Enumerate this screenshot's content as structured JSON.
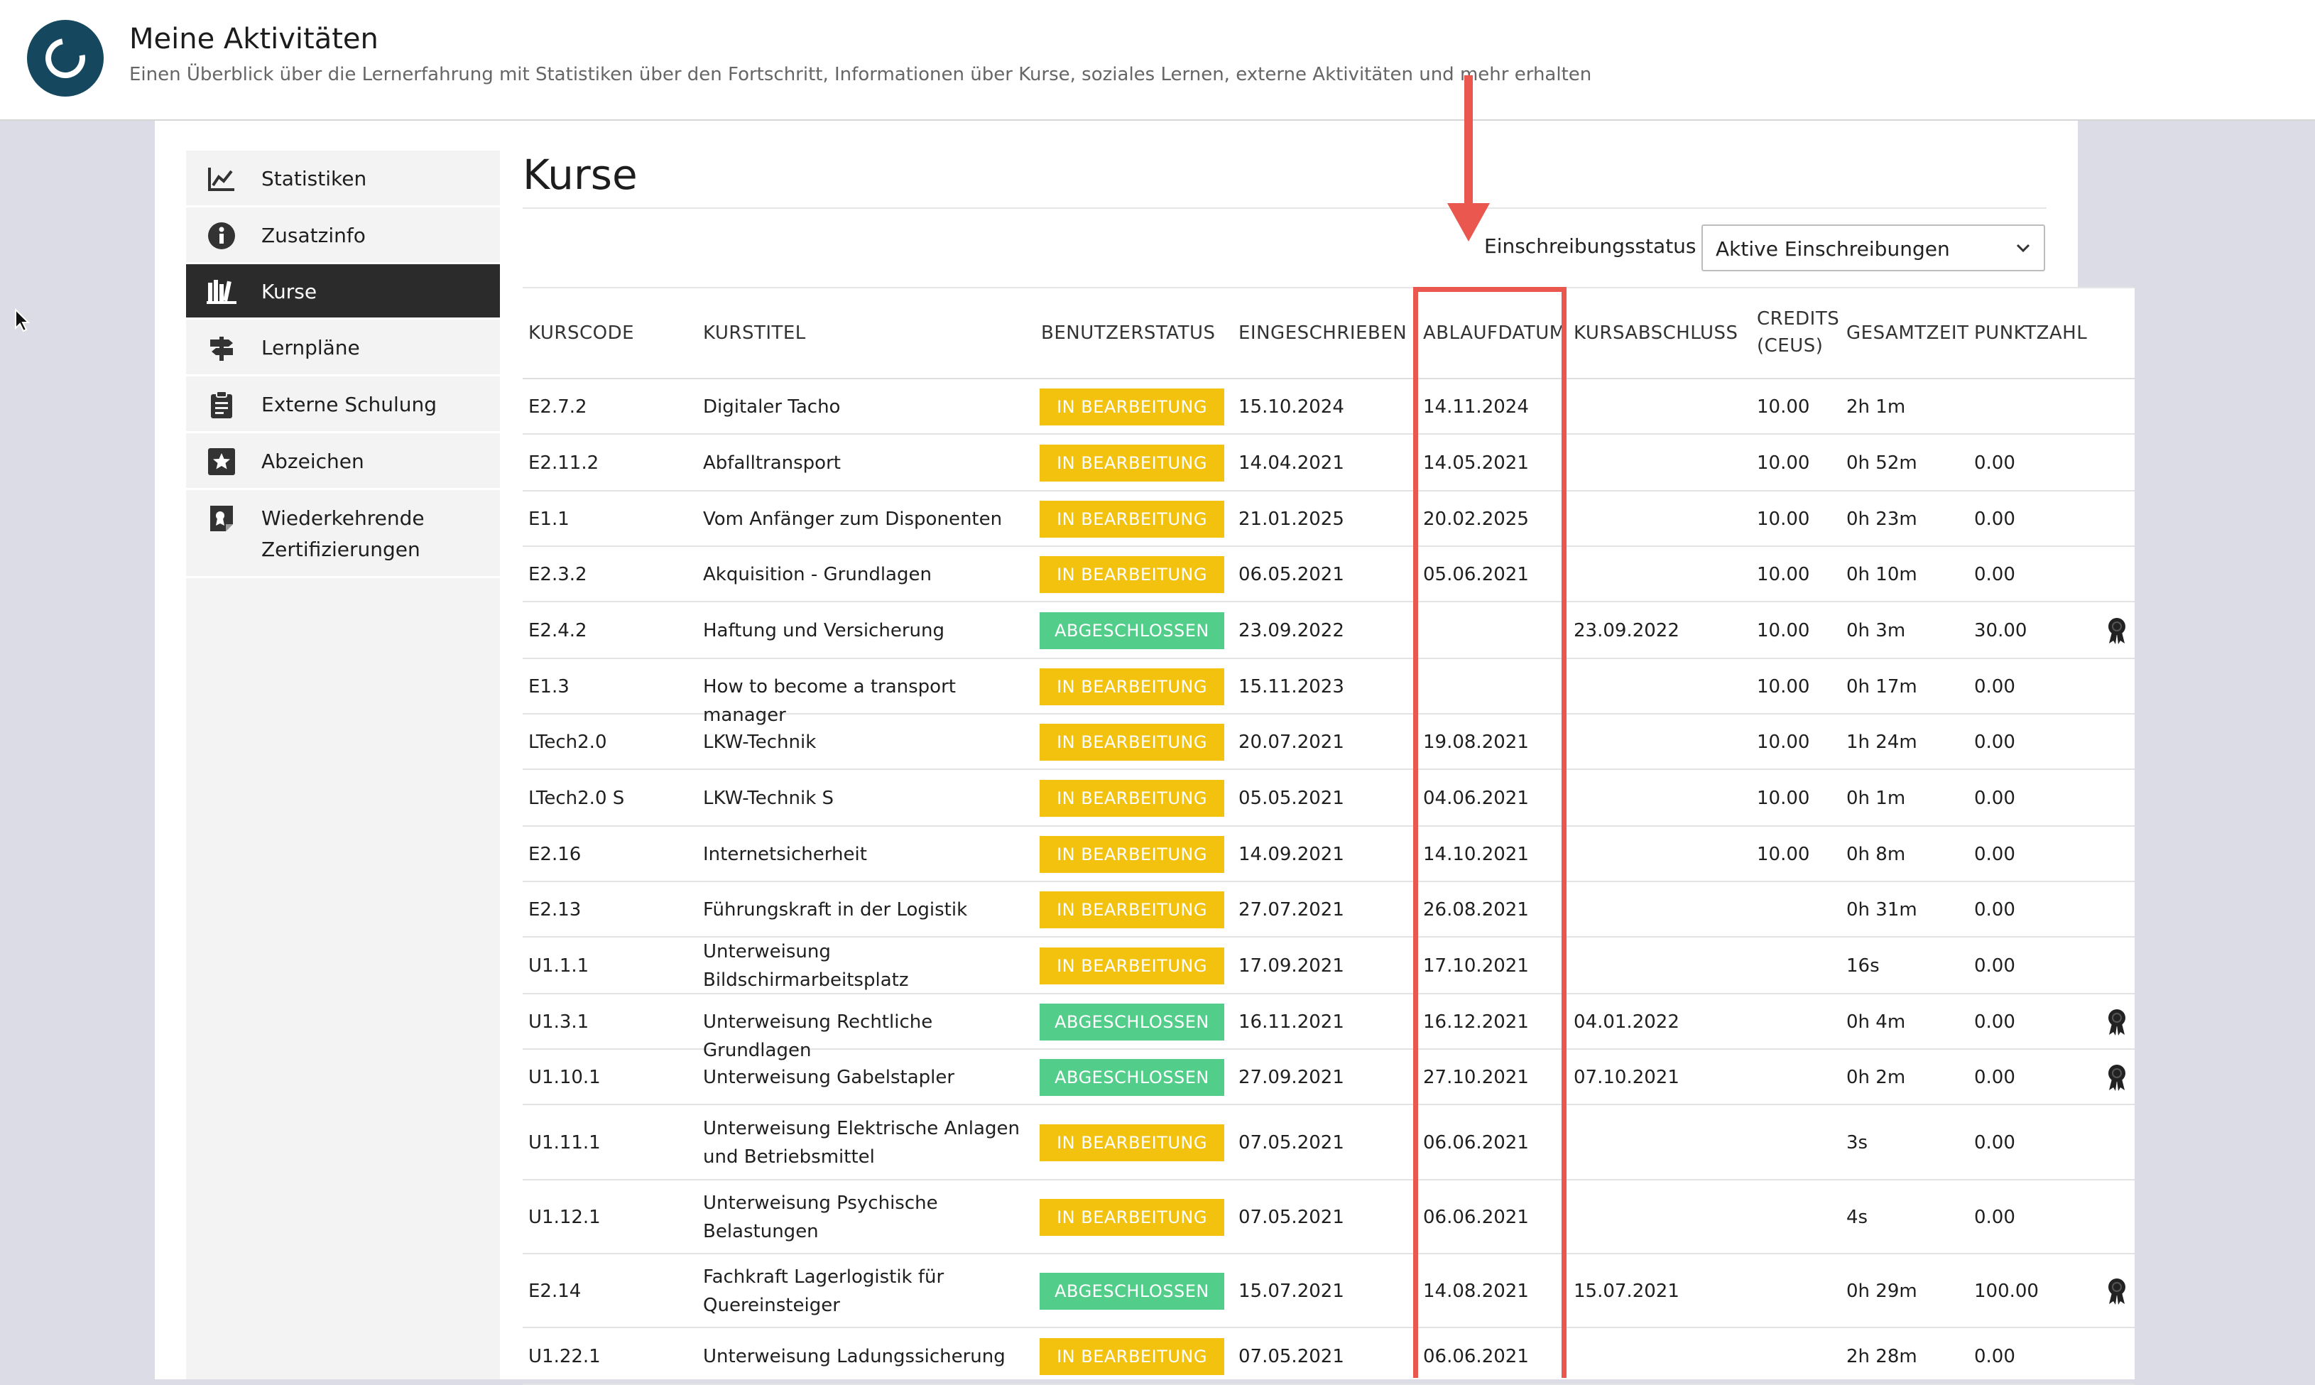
{
  "header": {
    "title": "Meine Aktivitäten",
    "subtitle": "Einen Überblick über die Lernerfahrung mit Statistiken über den Fortschritt, Informationen über Kurse, soziales Lernen, externe Aktivitäten und mehr erhalten"
  },
  "sidebar": {
    "items": [
      {
        "label": "Statistiken",
        "icon": "chart-icon"
      },
      {
        "label": "Zusatzinfo",
        "icon": "info-icon"
      },
      {
        "label": "Kurse",
        "icon": "library-icon",
        "active": true
      },
      {
        "label": "Lernpläne",
        "icon": "signpost-icon"
      },
      {
        "label": "Externe Schulung",
        "icon": "clipboard-icon"
      },
      {
        "label": "Abzeichen",
        "icon": "star-badge-icon"
      },
      {
        "label": "Wiederkehrende\nZertifizierungen",
        "icon": "certificate-icon"
      }
    ]
  },
  "main": {
    "title": "Kurse",
    "filter_label": "Einschreibungsstatus",
    "filter_value": "Aktive Einschreibungen"
  },
  "table": {
    "headers": [
      "KURSCODE",
      "KURSTITEL",
      "BENUTZERSTATUS",
      "EINGESCHRIEBEN",
      "ABLAUFDATUM",
      "KURSABSCHLUSS",
      "CREDITS (CEUS)",
      "GESAMTZEIT",
      "PUNKTZAHL"
    ],
    "rows": [
      {
        "code": "E2.7.2",
        "title": "Digitaler Tacho",
        "status": "IN BEARBEITUNG",
        "enrolled": "15.10.2024",
        "expiry": "14.11.2024",
        "completed": "",
        "credits": "10.00",
        "time": "2h 1m",
        "score": "",
        "award": false
      },
      {
        "code": "E2.11.2",
        "title": "Abfalltransport",
        "status": "IN BEARBEITUNG",
        "enrolled": "14.04.2021",
        "expiry": "14.05.2021",
        "completed": "",
        "credits": "10.00",
        "time": "0h 52m",
        "score": "0.00",
        "award": false
      },
      {
        "code": "E1.1",
        "title": "Vom Anfänger zum Disponenten",
        "status": "IN BEARBEITUNG",
        "enrolled": "21.01.2025",
        "expiry": "20.02.2025",
        "completed": "",
        "credits": "10.00",
        "time": "0h 23m",
        "score": "0.00",
        "award": false
      },
      {
        "code": "E2.3.2",
        "title": "Akquisition - Grundlagen",
        "status": "IN BEARBEITUNG",
        "enrolled": "06.05.2021",
        "expiry": "05.06.2021",
        "completed": "",
        "credits": "10.00",
        "time": "0h 10m",
        "score": "0.00",
        "award": false
      },
      {
        "code": "E2.4.2",
        "title": "Haftung und Versicherung",
        "status": "ABGESCHLOSSEN",
        "enrolled": "23.09.2022",
        "expiry": "",
        "completed": "23.09.2022",
        "credits": "10.00",
        "time": "0h 3m",
        "score": "30.00",
        "award": true
      },
      {
        "code": "E1.3",
        "title": "How to become a transport manager",
        "status": "IN BEARBEITUNG",
        "enrolled": "15.11.2023",
        "expiry": "",
        "completed": "",
        "credits": "10.00",
        "time": "0h 17m",
        "score": "0.00",
        "award": false
      },
      {
        "code": "LTech2.0",
        "title": "LKW-Technik",
        "status": "IN BEARBEITUNG",
        "enrolled": "20.07.2021",
        "expiry": "19.08.2021",
        "completed": "",
        "credits": "10.00",
        "time": "1h 24m",
        "score": "0.00",
        "award": false
      },
      {
        "code": "LTech2.0 S",
        "title": "LKW-Technik S",
        "status": "IN BEARBEITUNG",
        "enrolled": "05.05.2021",
        "expiry": "04.06.2021",
        "completed": "",
        "credits": "10.00",
        "time": "0h 1m",
        "score": "0.00",
        "award": false
      },
      {
        "code": "E2.16",
        "title": "Internetsicherheit",
        "status": "IN BEARBEITUNG",
        "enrolled": "14.09.2021",
        "expiry": "14.10.2021",
        "completed": "",
        "credits": "10.00",
        "time": "0h 8m",
        "score": "0.00",
        "award": false
      },
      {
        "code": "E2.13",
        "title": "Führungskraft in der Logistik",
        "status": "IN BEARBEITUNG",
        "enrolled": "27.07.2021",
        "expiry": "26.08.2021",
        "completed": "",
        "credits": "",
        "time": "0h 31m",
        "score": "0.00",
        "award": false
      },
      {
        "code": "U1.1.1",
        "title": "Unterweisung Bildschirmarbeitsplatz",
        "status": "IN BEARBEITUNG",
        "enrolled": "17.09.2021",
        "expiry": "17.10.2021",
        "completed": "",
        "credits": "",
        "time": "16s",
        "score": "0.00",
        "award": false
      },
      {
        "code": "U1.3.1",
        "title": "Unterweisung Rechtliche Grundlagen",
        "status": "ABGESCHLOSSEN",
        "enrolled": "16.11.2021",
        "expiry": "16.12.2021",
        "completed": "04.01.2022",
        "credits": "",
        "time": "0h 4m",
        "score": "0.00",
        "award": true
      },
      {
        "code": "U1.10.1",
        "title": "Unterweisung Gabelstapler",
        "status": "ABGESCHLOSSEN",
        "enrolled": "27.09.2021",
        "expiry": "27.10.2021",
        "completed": "07.10.2021",
        "credits": "",
        "time": "0h 2m",
        "score": "0.00",
        "award": true
      },
      {
        "code": "U1.11.1",
        "title": "Unterweisung Elektrische Anlagen und Betriebsmittel",
        "status": "IN BEARBEITUNG",
        "enrolled": "07.05.2021",
        "expiry": "06.06.2021",
        "completed": "",
        "credits": "",
        "time": "3s",
        "score": "0.00",
        "award": false
      },
      {
        "code": "U1.12.1",
        "title": "Unterweisung Psychische Belastungen",
        "status": "IN BEARBEITUNG",
        "enrolled": "07.05.2021",
        "expiry": "06.06.2021",
        "completed": "",
        "credits": "",
        "time": "4s",
        "score": "0.00",
        "award": false
      },
      {
        "code": "E2.14",
        "title": "Fachkraft Lagerlogistik für Quereinsteiger",
        "status": "ABGESCHLOSSEN",
        "enrolled": "15.07.2021",
        "expiry": "14.08.2021",
        "completed": "15.07.2021",
        "credits": "",
        "time": "0h 29m",
        "score": "100.00",
        "award": true
      },
      {
        "code": "U1.22.1",
        "title": "Unterweisung Ladungssicherung",
        "status": "IN BEARBEITUNG",
        "enrolled": "07.05.2021",
        "expiry": "06.06.2021",
        "completed": "",
        "credits": "",
        "time": "2h 28m",
        "score": "0.00",
        "award": false
      }
    ]
  },
  "colors": {
    "in_progress": "#f2c20e",
    "completed": "#52cd8a",
    "annotation": "#e9574f",
    "logo": "#15485f"
  }
}
